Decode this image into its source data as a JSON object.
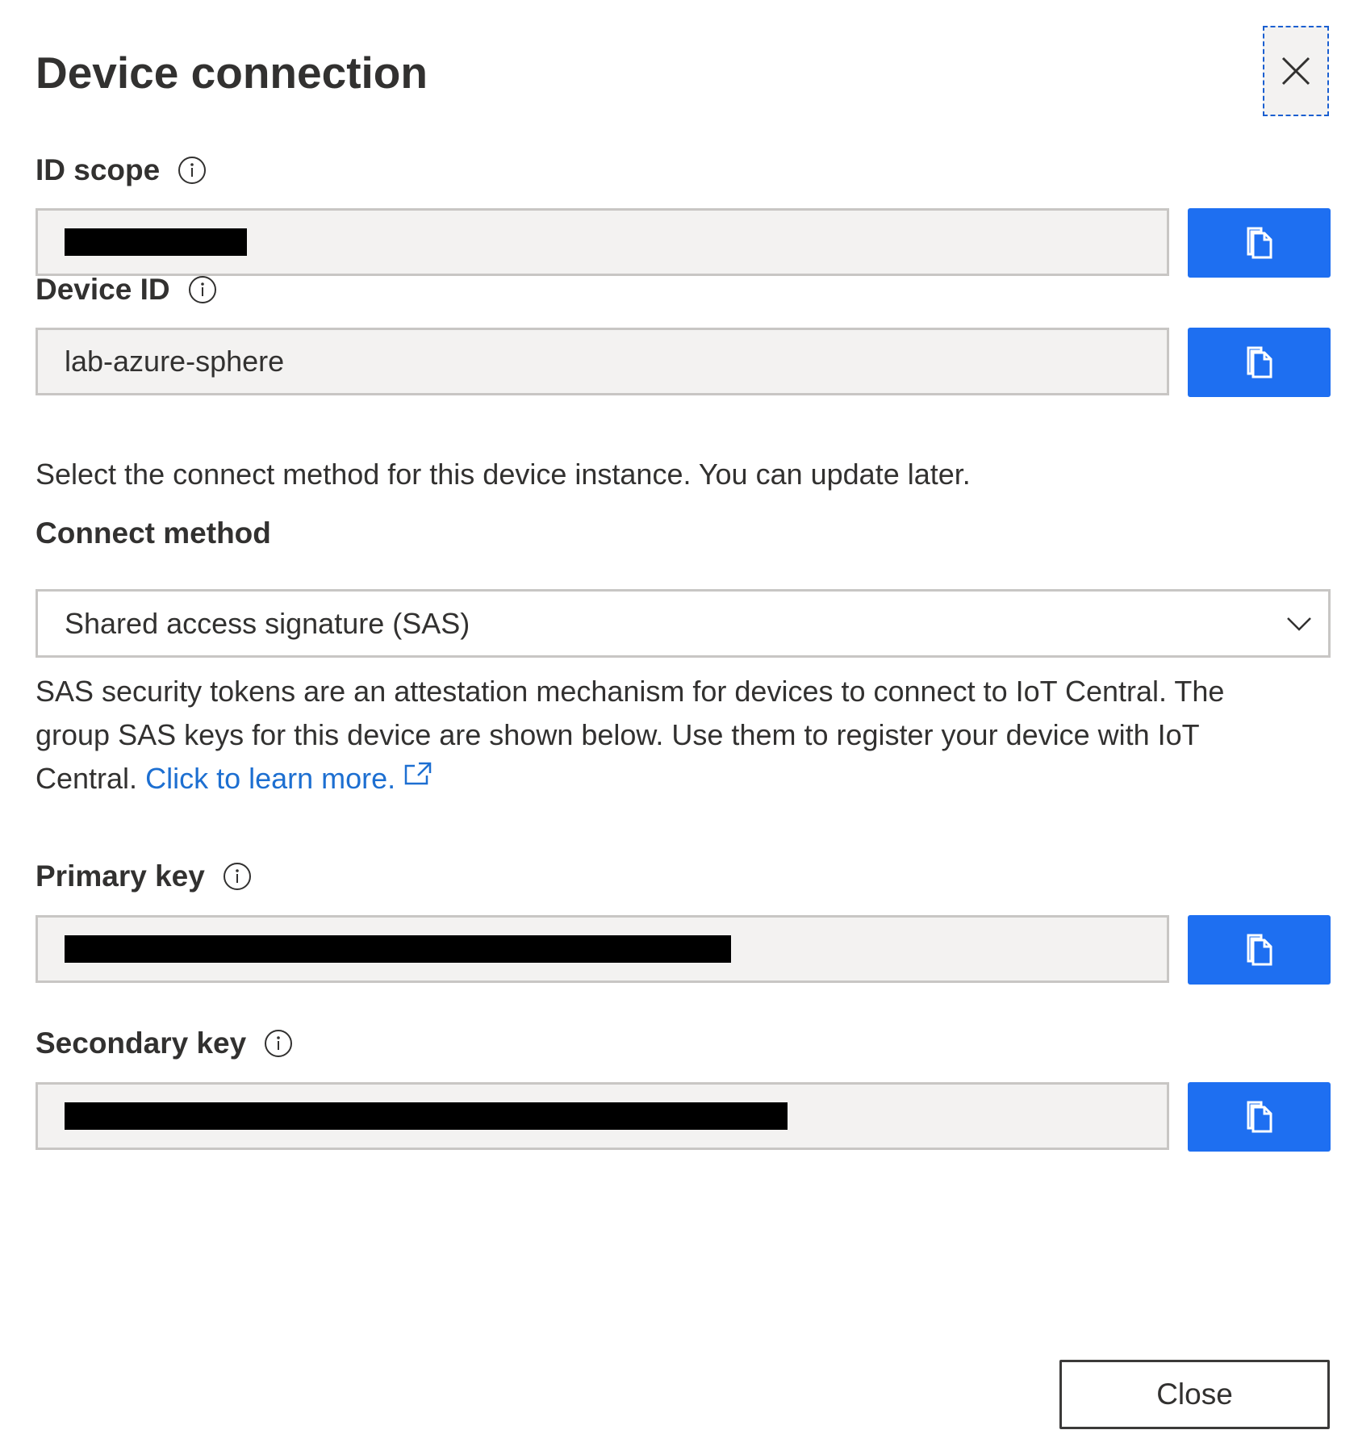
{
  "dialog": {
    "title": "Device connection",
    "close_icon": "close-icon"
  },
  "id_scope": {
    "label": "ID scope",
    "value": "",
    "redacted": true
  },
  "device_id": {
    "label": "Device ID",
    "value": "lab-azure-sphere"
  },
  "connect_hint": "Select the connect method for this device instance. You can update later.",
  "connect_method": {
    "label": "Connect method",
    "selected": "Shared access signature (SAS)"
  },
  "sas_description": {
    "text": "SAS security tokens are an attestation mechanism for devices to connect to IoT Central. The group SAS keys for this device are shown below. Use them to register your device with IoT Central.",
    "link_text": "Click to learn more."
  },
  "primary_key": {
    "label": "Primary key",
    "value": "",
    "redacted": true
  },
  "secondary_key": {
    "label": "Secondary key",
    "value": "",
    "redacted": true
  },
  "footer": {
    "close_label": "Close"
  },
  "colors": {
    "accent": "#1e6ff1",
    "link": "#1d6fd1",
    "field_bg": "#f3f2f1",
    "border": "#c8c6c4",
    "text": "#323130"
  },
  "icons": {
    "info": "info-icon",
    "copy": "copy-icon",
    "chevron": "chevron-down-icon",
    "external": "external-link-icon"
  }
}
